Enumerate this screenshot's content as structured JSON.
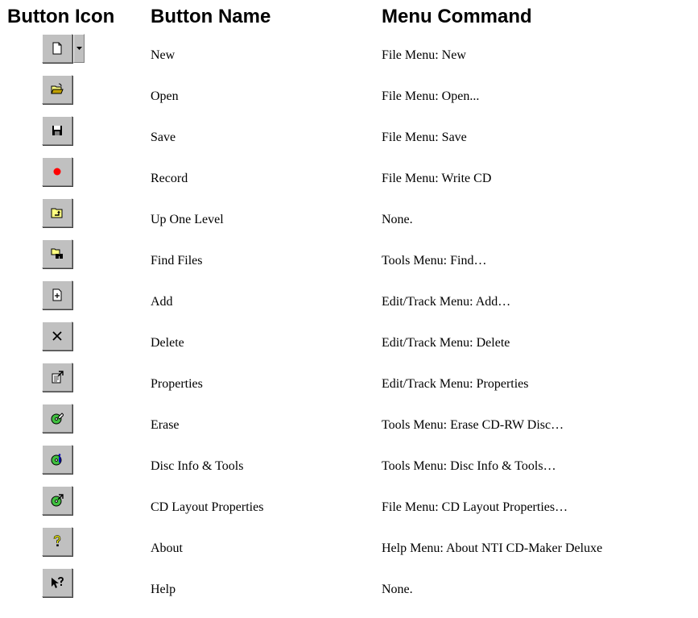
{
  "headers": {
    "icon": "Button Icon",
    "name": "Button Name",
    "command": "Menu Command"
  },
  "rows": [
    {
      "icon": "new-document-icon",
      "name": "New",
      "command": "File Menu:  New"
    },
    {
      "icon": "open-folder-icon",
      "name": "Open",
      "command": "File Menu:  Open..."
    },
    {
      "icon": "floppy-save-icon",
      "name": "Save",
      "command": "File Menu:  Save"
    },
    {
      "icon": "record-dot-icon",
      "name": "Record",
      "command": "File Menu:  Write CD"
    },
    {
      "icon": "up-folder-icon",
      "name": "Up One Level",
      "command": "None."
    },
    {
      "icon": "find-files-icon",
      "name": "Find Files",
      "command": "Tools Menu:  Find…"
    },
    {
      "icon": "add-file-icon",
      "name": "Add",
      "command": "Edit/Track Menu:  Add…"
    },
    {
      "icon": "delete-x-icon",
      "name": "Delete",
      "command": "Edit/Track Menu:  Delete"
    },
    {
      "icon": "properties-icon",
      "name": "Properties",
      "command": "Edit/Track Menu:  Properties"
    },
    {
      "icon": "erase-disc-icon",
      "name": "Erase",
      "command": "Tools Menu:  Erase CD-RW Disc…"
    },
    {
      "icon": "disc-info-icon",
      "name": "Disc Info & Tools",
      "command": "Tools Menu:  Disc Info & Tools…"
    },
    {
      "icon": "cd-layout-icon",
      "name": "CD Layout Properties",
      "command": "File Menu:  CD Layout Properties…"
    },
    {
      "icon": "about-question-icon",
      "name": "About",
      "command": "Help Menu:   About NTI CD-Maker Deluxe"
    },
    {
      "icon": "help-pointer-icon",
      "name": "Help",
      "command": "None."
    }
  ]
}
